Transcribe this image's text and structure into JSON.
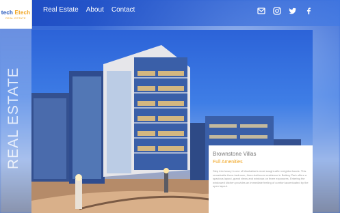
{
  "logo": {
    "name_a": "tech",
    "name_b": "Etech",
    "tagline": "REAL ESTATE"
  },
  "nav": {
    "items": [
      {
        "label": "Real Estate"
      },
      {
        "label": "About"
      },
      {
        "label": "Contact"
      }
    ]
  },
  "social": {
    "icons": [
      "mail-icon",
      "instagram-icon",
      "twitter-icon",
      "facebook-icon"
    ]
  },
  "sidebar": {
    "vertical_label": "REAL ESTATE"
  },
  "card": {
    "title": "Brownstone Villas",
    "subtitle": "Full Amenities",
    "body": "Step into luxury in one of Manhattan's most sought-after neighborhoods. This remarkable three-bedroom, three-bathroom residence in Battery Park offers a spacious layout, grand views and windows on three exposures. Entering the windowed kitchen provides an immediate feeling of comfort accentuated by the open layout."
  },
  "colors": {
    "accent": "#f0a21a",
    "brand_blue": "#1b4fb8",
    "nav_text": "#ffffff"
  }
}
